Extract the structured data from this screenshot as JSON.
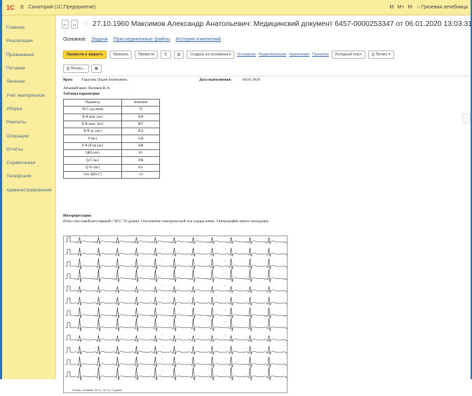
{
  "topbar": {
    "app_title": "Санаторий  (1С:Предприятие)",
    "logo": "1С",
    "right_items": [
      "M",
      "M+",
      "M-"
    ],
    "user": "Грязевая лечебница"
  },
  "sidebar": {
    "items": [
      {
        "label": "Главное"
      },
      {
        "label": "Реализация"
      },
      {
        "label": "Проживание"
      },
      {
        "label": "Питание"
      },
      {
        "label": "Лечение"
      },
      {
        "label": "Учёт материалов"
      },
      {
        "label": "Уборка"
      },
      {
        "label": "Ремонты"
      },
      {
        "label": "Операции"
      },
      {
        "label": "Отчёты"
      },
      {
        "label": "Справочники"
      },
      {
        "label": "Телефония"
      },
      {
        "label": "Администрирование"
      }
    ]
  },
  "header": {
    "title": "27.10.1960 Максимов Александр Анатольевич: Медицинский документ 6457-0000253347 от 06.01.2020 13:03:31"
  },
  "tabs": [
    {
      "label": "Основное"
    },
    {
      "label": "Задачи"
    },
    {
      "label": "Присоединенные файлы"
    },
    {
      "label": "История изменений"
    }
  ],
  "toolbar": {
    "post_close": "Провести и закрыть",
    "save": "Записать",
    "post": "Провести",
    "create_based": "Создать на основании",
    "links": [
      "Основание",
      "Редактирование",
      "Назначения",
      "Просмотр"
    ],
    "source_text": "Исходный текст",
    "print": "Печать"
  },
  "toolbar2": {
    "print": "Печать..."
  },
  "document": {
    "doctor_label": "Врач:",
    "doctor_name": "Тарасова Лидия Евгеньевна",
    "date_label": "Дата выполнения:",
    "date_value": "06.01.2020",
    "attending": "Лечащий врач: Валиков В.А.",
    "table_title": "Таблица параметров",
    "table_headers": [
      "Параметр",
      "Значение"
    ],
    "table_rows": [
      [
        "ЧСС (уд./мин)",
        "70"
      ],
      [
        "R-R мин. (мс)",
        "839"
      ],
      [
        "R-R макс. (мс)",
        "867"
      ],
      [
        "R-R ср. (мс)",
        "854"
      ],
      [
        "P (мс)",
        "128"
      ],
      [
        "P-R (P-Q) (мс)",
        "188"
      ],
      [
        "QRS (мс)",
        "82"
      ],
      [
        "Q-T (мс)",
        "398"
      ],
      [
        "Q-Tc (мс)",
        "431"
      ],
      [
        "Ось QRS (°)",
        "-12"
      ]
    ],
    "interp_label": "Интерпретация:",
    "interp_text": "Ритм синусовый регулярный с ЧСС 70 уд/мин. Отклонение электрической оси сердца влево. Гипертрофия левого желудочка.",
    "ecg_footer": "25 мм/с, 10 мм/мВ, 35 Гц, ~50 Гц, 70 уд/мин"
  }
}
